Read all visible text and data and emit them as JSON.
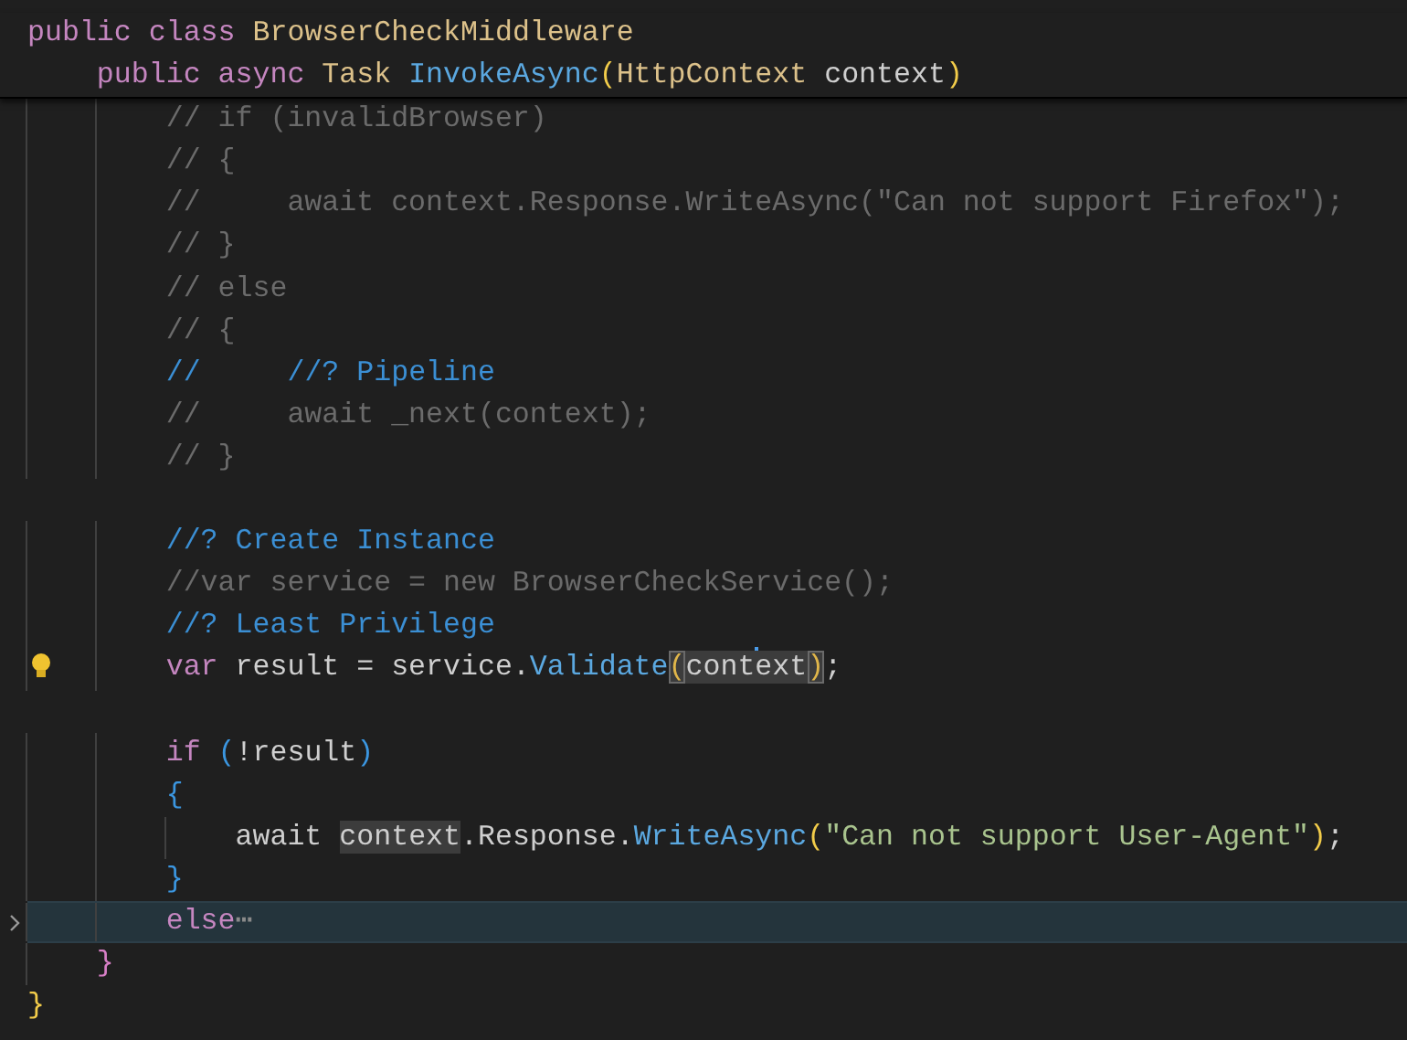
{
  "sticky_lines": [
    {
      "tokens": [
        {
          "text": "public class ",
          "kind": "keyword"
        },
        {
          "text": "BrowserCheckMiddleware",
          "kind": "type"
        }
      ]
    },
    {
      "tokens": [
        {
          "text": "    public async ",
          "kind": "keyword"
        },
        {
          "text": "Task ",
          "kind": "type"
        },
        {
          "text": "InvokeAsync",
          "kind": "function"
        },
        {
          "text": "(",
          "kind": "paren1"
        },
        {
          "text": "HttpContext ",
          "kind": "type"
        },
        {
          "text": "context",
          "kind": "plain"
        },
        {
          "text": ")",
          "kind": "paren1"
        }
      ]
    }
  ],
  "lines": [
    {
      "selected": false,
      "tokens": [
        {
          "text": "        // if (invalidBrowser)",
          "kind": "comment"
        }
      ]
    },
    {
      "selected": false,
      "tokens": [
        {
          "text": "        // {",
          "kind": "comment"
        }
      ]
    },
    {
      "selected": false,
      "tokens": [
        {
          "text": "        //     await context.Response.WriteAsync(\"Can not support Firefox\");",
          "kind": "comment"
        }
      ]
    },
    {
      "selected": false,
      "tokens": [
        {
          "text": "        // }",
          "kind": "comment"
        }
      ]
    },
    {
      "selected": false,
      "tokens": [
        {
          "text": "        // else",
          "kind": "comment"
        }
      ]
    },
    {
      "selected": false,
      "tokens": [
        {
          "text": "        // {",
          "kind": "comment"
        }
      ]
    },
    {
      "selected": false,
      "tokens": [
        {
          "text": "        //",
          "kind": "comment_tag"
        },
        {
          "text": "     //? Pipeline",
          "kind": "comment_tag"
        }
      ]
    },
    {
      "selected": false,
      "tokens": [
        {
          "text": "        //     await _next(context);",
          "kind": "comment"
        }
      ]
    },
    {
      "selected": false,
      "tokens": [
        {
          "text": "        // }",
          "kind": "comment"
        }
      ]
    },
    {
      "selected": false
    },
    {
      "selected": false,
      "tokens": [
        {
          "text": "        //? Create Instance",
          "kind": "comment_tag"
        }
      ]
    },
    {
      "selected": false,
      "tokens": [
        {
          "text": "        //var service = new BrowserCheckService();",
          "kind": "comment"
        }
      ]
    },
    {
      "selected": false,
      "tokens": [
        {
          "text": "        //? Least Privilege",
          "kind": "comment_tag"
        }
      ]
    },
    {
      "selected": false,
      "kind": "lightbulb",
      "tokens": [
        {
          "text": "        var ",
          "kind": "keyword"
        },
        {
          "text": "result = service.",
          "kind": "plain"
        },
        {
          "text": "Validate",
          "kind": "function"
        },
        {
          "text": "(",
          "kind": "paren_match"
        },
        {
          "text": "cont",
          "kind": "word_highlight"
        },
        {
          "kind": "caret"
        },
        {
          "text": "ext",
          "kind": "word_highlight"
        },
        {
          "text": ")",
          "kind": "paren_match"
        },
        {
          "text": ";",
          "kind": "plain"
        }
      ]
    },
    {
      "selected": false
    },
    {
      "selected": false,
      "tokens": [
        {
          "text": "        if ",
          "kind": "keyword"
        },
        {
          "text": "(",
          "kind": "paren2"
        },
        {
          "text": "!result",
          "kind": "plain"
        },
        {
          "text": ")",
          "kind": "paren2"
        }
      ]
    },
    {
      "selected": false,
      "tokens": [
        {
          "text": "        {",
          "kind": "paren2"
        }
      ]
    },
    {
      "selected": false,
      "tokens": [
        {
          "text": "            await ",
          "kind": "plain"
        },
        {
          "text": "context",
          "kind": "word_highlight"
        },
        {
          "text": ".Response.",
          "kind": "plain"
        },
        {
          "text": "WriteAsync",
          "kind": "function"
        },
        {
          "text": "(",
          "kind": "paren1"
        },
        {
          "text": "\"Can not support User-Agent\"",
          "kind": "string"
        },
        {
          "text": ")",
          "kind": "paren1"
        },
        {
          "text": ";",
          "kind": "plain"
        }
      ]
    },
    {
      "selected": false,
      "tokens": [
        {
          "text": "        }",
          "kind": "paren2"
        }
      ]
    },
    {
      "selected": true,
      "kind": "folded",
      "tokens": [
        {
          "text": "        else",
          "kind": "keyword"
        },
        {
          "text": "⋯",
          "kind": "fold_ellipsis"
        }
      ]
    },
    {
      "selected": false,
      "tokens": [
        {
          "text": "    }",
          "kind": "paren3"
        }
      ]
    },
    {
      "selected": false,
      "tokens": [
        {
          "text": "}",
          "kind": "paren1"
        }
      ]
    }
  ]
}
